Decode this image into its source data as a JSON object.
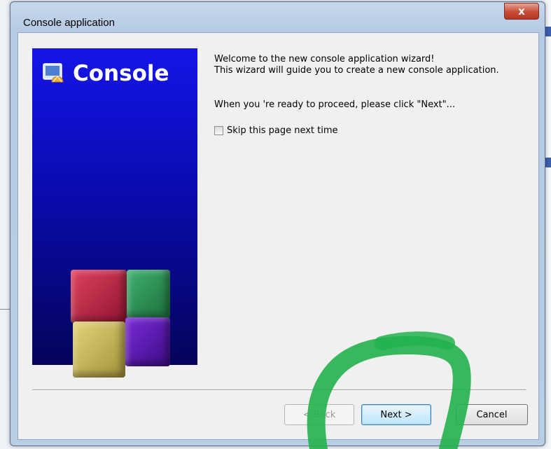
{
  "window": {
    "title": "Console application",
    "close_label": "x"
  },
  "banner": {
    "title": "Console",
    "colors": {
      "background_top": "#1515e8",
      "background_bottom": "#04045a",
      "cube_red": "#c7243f",
      "cube_green": "#2f9a5c",
      "cube_yellow": "#cbb95a",
      "cube_purple": "#5a1cb0"
    }
  },
  "content": {
    "welcome_line1": "Welcome to the new console application wizard!",
    "welcome_line2": "This wizard will guide you to create a new console application.",
    "proceed_text": "When you 're ready to proceed, please click \"Next\"...",
    "skip_checkbox_label": "Skip this page next time",
    "skip_checked": false
  },
  "buttons": {
    "back_label": "< Back",
    "next_label": "Next >",
    "cancel_label": "Cancel",
    "back_enabled": false
  },
  "annotation": {
    "color": "#22b14c",
    "shape": "hand-drawn-circle-around-next-button"
  }
}
